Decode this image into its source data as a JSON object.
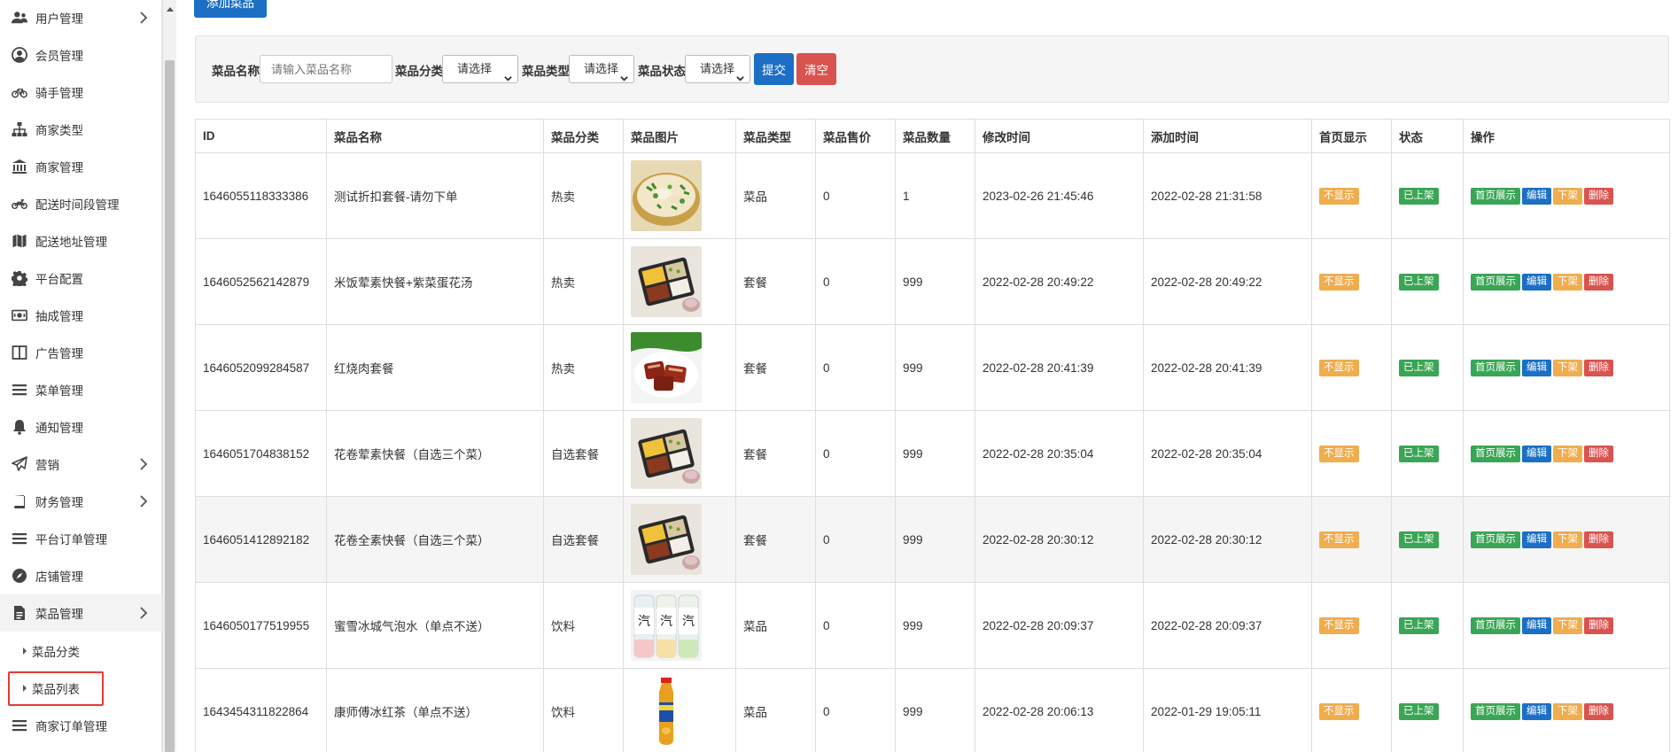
{
  "sidebar": {
    "items": [
      {
        "label": "用户管理",
        "icon": "users-icon",
        "chevron": true
      },
      {
        "label": "会员管理",
        "icon": "user-circle-icon",
        "chevron": false
      },
      {
        "label": "骑手管理",
        "icon": "bicycle-icon",
        "chevron": false
      },
      {
        "label": "商家类型",
        "icon": "sitemap-icon",
        "chevron": false
      },
      {
        "label": "商家管理",
        "icon": "bank-icon",
        "chevron": false
      },
      {
        "label": "配送时间段管理",
        "icon": "motorcycle-icon",
        "chevron": false
      },
      {
        "label": "配送地址管理",
        "icon": "map-icon",
        "chevron": false
      },
      {
        "label": "平台配置",
        "icon": "gear-icon",
        "chevron": false
      },
      {
        "label": "抽成管理",
        "icon": "money-icon",
        "chevron": false
      },
      {
        "label": "广告管理",
        "icon": "columns-icon",
        "chevron": false
      },
      {
        "label": "菜单管理",
        "icon": "bars-icon",
        "chevron": false
      },
      {
        "label": "通知管理",
        "icon": "bell-icon",
        "chevron": false
      },
      {
        "label": "营销",
        "icon": "paper-plane-icon",
        "chevron": true
      },
      {
        "label": "财务管理",
        "icon": "book-icon",
        "chevron": true
      },
      {
        "label": "平台订单管理",
        "icon": "bars-icon",
        "chevron": false
      },
      {
        "label": "店铺管理",
        "icon": "compass-icon",
        "chevron": false
      },
      {
        "label": "菜品管理",
        "icon": "file-icon",
        "chevron": true
      }
    ],
    "sub_items": [
      {
        "label": "菜品分类"
      },
      {
        "label": "菜品列表"
      }
    ],
    "last_item": {
      "label": "商家订单管理",
      "icon": "bars-icon"
    }
  },
  "toolbar": {
    "add_label": "添加菜品"
  },
  "filter": {
    "name_label": "菜品名称:",
    "name_placeholder": "请输入菜品名称",
    "category_label": "菜品分类:",
    "category_value": "请选择",
    "type_label": "菜品类型:",
    "type_value": "请选择",
    "status_label": "菜品状态:",
    "status_value": "请选择",
    "submit_label": "提交",
    "clear_label": "清空"
  },
  "table": {
    "headers": [
      "ID",
      "菜品名称",
      "菜品分类",
      "菜品图片",
      "菜品类型",
      "菜品售价",
      "菜品数量",
      "修改时间",
      "添加时间",
      "首页显示",
      "状态",
      "操作"
    ],
    "rows": [
      {
        "id": "1646055118333386",
        "name": "测试折扣套餐-请勿下单",
        "category": "热卖",
        "image": "fish-dish",
        "type": "菜品",
        "price": "0",
        "qty": "1",
        "modified": "2023-02-26 21:45:46",
        "added": "2022-02-28 21:31:58",
        "home": "不显示",
        "status": "已上架"
      },
      {
        "id": "1646052562142879",
        "name": "米饭荤素快餐+紫菜蛋花汤",
        "category": "热卖",
        "image": "bento-box",
        "type": "套餐",
        "price": "0",
        "qty": "999",
        "modified": "2022-02-28 20:49:22",
        "added": "2022-02-28 20:49:22",
        "home": "不显示",
        "status": "已上架"
      },
      {
        "id": "1646052099284587",
        "name": "红烧肉套餐",
        "category": "热卖",
        "image": "braised-pork",
        "type": "套餐",
        "price": "0",
        "qty": "999",
        "modified": "2022-02-28 20:41:39",
        "added": "2022-02-28 20:41:39",
        "home": "不显示",
        "status": "已上架"
      },
      {
        "id": "1646051704838152",
        "name": "花卷荤素快餐（自选三个菜）",
        "category": "自选套餐",
        "image": "bento-box",
        "type": "套餐",
        "price": "0",
        "qty": "999",
        "modified": "2022-02-28 20:35:04",
        "added": "2022-02-28 20:35:04",
        "home": "不显示",
        "status": "已上架"
      },
      {
        "id": "1646051412892182",
        "name": "花卷全素快餐（自选三个菜）",
        "category": "自选套餐",
        "image": "bento-box",
        "type": "套餐",
        "price": "0",
        "qty": "999",
        "modified": "2022-02-28 20:30:12",
        "added": "2022-02-28 20:30:12",
        "home": "不显示",
        "status": "已上架"
      },
      {
        "id": "1646050177519955",
        "name": "蜜雪冰城气泡水（单点不送）",
        "category": "饮料",
        "image": "soda-bottles",
        "type": "菜品",
        "price": "0",
        "qty": "999",
        "modified": "2022-02-28 20:09:37",
        "added": "2022-02-28 20:09:37",
        "home": "不显示",
        "status": "已上架"
      },
      {
        "id": "1643454311822864",
        "name": "康师傅冰红茶（单点不送）",
        "category": "饮料",
        "image": "tea-bottle",
        "type": "菜品",
        "price": "0",
        "qty": "999",
        "modified": "2022-02-28 20:06:13",
        "added": "2022-01-29 19:05:11",
        "home": "不显示",
        "status": "已上架"
      }
    ],
    "actions": {
      "home_show": "首页展示",
      "edit": "编辑",
      "off_shelf": "下架",
      "delete": "删除"
    }
  }
}
